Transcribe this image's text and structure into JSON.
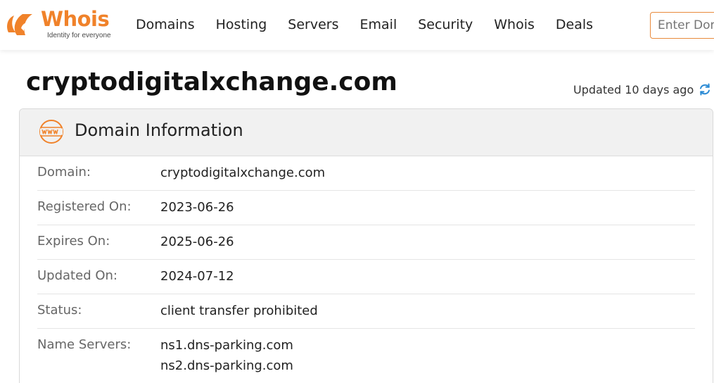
{
  "brand": {
    "name": "Whois",
    "tagline": "Identity for everyone",
    "accent": "#f0822a"
  },
  "nav": {
    "items": [
      {
        "label": "Domains"
      },
      {
        "label": "Hosting"
      },
      {
        "label": "Servers"
      },
      {
        "label": "Email"
      },
      {
        "label": "Security"
      },
      {
        "label": "Whois"
      },
      {
        "label": "Deals"
      }
    ]
  },
  "search": {
    "placeholder": "Enter Domain"
  },
  "page": {
    "domain": "cryptodigitalxchange.com",
    "updated": "Updated 10 days ago",
    "refresh_icon": "refresh-icon"
  },
  "card": {
    "title": "Domain Information",
    "icon": "www-icon",
    "rows": [
      {
        "label": "Domain:",
        "value": "cryptodigitalxchange.com"
      },
      {
        "label": "Registered On:",
        "value": "2023-06-26"
      },
      {
        "label": "Expires On:",
        "value": "2025-06-26"
      },
      {
        "label": "Updated On:",
        "value": "2024-07-12"
      },
      {
        "label": "Status:",
        "value": "client transfer prohibited"
      },
      {
        "label": "Name Servers:",
        "values": [
          "ns1.dns-parking.com",
          "ns2.dns-parking.com"
        ]
      }
    ]
  }
}
